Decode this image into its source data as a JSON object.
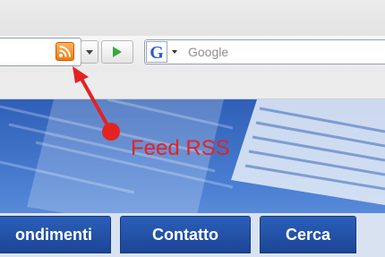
{
  "browser": {
    "search_placeholder": "Google",
    "search_engine_letter": "G",
    "colors": {
      "feed_icon": "#f58a1f",
      "go_arrow": "#3aa83a",
      "engine_blue": "#2a5bd7"
    }
  },
  "nav": {
    "tabs": [
      {
        "label": "ondimenti"
      },
      {
        "label": "Contatto"
      },
      {
        "label": "Cerca"
      }
    ],
    "tab_color": "#1f4ea3"
  },
  "annotation": {
    "label": "Feed RSS",
    "color": "#e52222"
  }
}
